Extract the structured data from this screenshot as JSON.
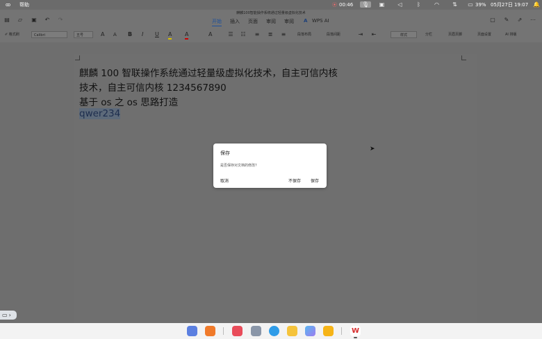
{
  "status_bar": {
    "menu": "帮助",
    "record_time": "00:46",
    "battery": "39%",
    "datetime": "05月27日 19:07"
  },
  "window": {
    "title": "麒麟100智能操作系统通过轻量级虚拟化技术"
  },
  "ribbon": {
    "tabs": [
      {
        "label": "开始",
        "active": true
      },
      {
        "label": "插入",
        "active": false
      },
      {
        "label": "页面",
        "active": false
      },
      {
        "label": "审阅",
        "active": false
      },
      {
        "label": "审阅",
        "active": false
      },
      {
        "label": "WPS AI",
        "active": false
      }
    ],
    "format_painter": "格式刷",
    "font_name": "Calibri",
    "font_size": "五号",
    "format_buttons": [
      "A",
      "A",
      "B",
      "I",
      "U",
      "A",
      "A"
    ],
    "paragraph_buttons": [
      "段落布局",
      "段落间距"
    ],
    "style_select": "样式",
    "right_buttons": [
      "分栏",
      "页眉页脚",
      "页面设置",
      "AI 排版"
    ]
  },
  "document": {
    "lines": [
      "麒麟 100 智联操作系统通过轻量级虚拟化技术，自主可信内核",
      "技术，自主可信内核 1234567890",
      "基于 os 之 os 思路打造",
      "qwer234"
    ]
  },
  "dialog": {
    "title": "保存",
    "message": "是否保存对文档的修改?",
    "cancel": "取消",
    "dont_save": "不保存",
    "save": "保存"
  },
  "icons": {
    "app": "kylin-logo-icon",
    "dock": [
      "launcher-icon",
      "office-icon",
      "file-manager-icon",
      "settings-icon",
      "browser-icon",
      "notes-icon",
      "gallery-icon",
      "memo-icon",
      "wps-icon"
    ]
  },
  "colors": {
    "accent": "#1b4f9c",
    "dialog_bg": "#ffffff",
    "selection": "#5d6a7a"
  }
}
